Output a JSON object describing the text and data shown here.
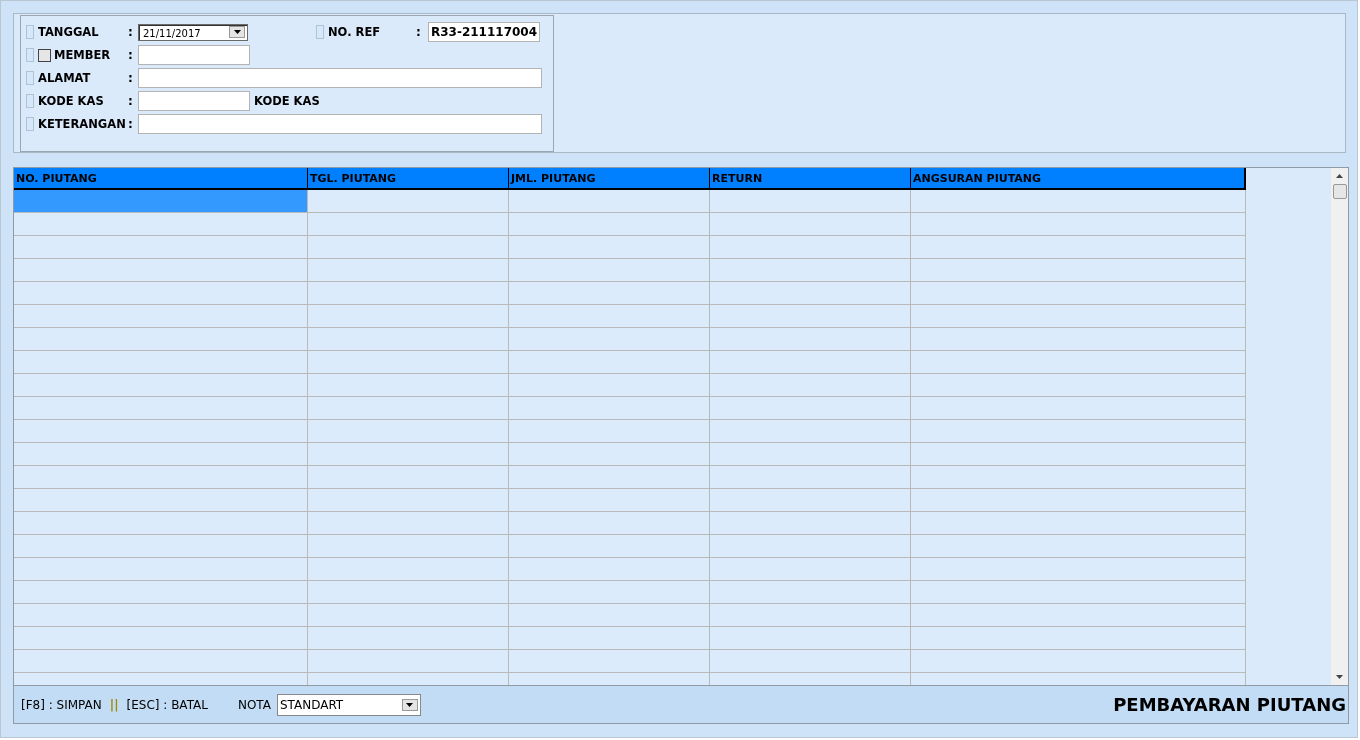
{
  "form": {
    "fields": [
      {
        "kind": "date",
        "label": "TANGGAL",
        "colon": ":",
        "value": "21/11/2017"
      },
      {
        "kind": "member",
        "label": "MEMBER",
        "colon": ":",
        "checked": false
      },
      {
        "kind": "wide",
        "label": "ALAMAT",
        "colon": ":"
      },
      {
        "kind": "kas",
        "label": "KODE KAS",
        "colon": ":",
        "suffix": "KODE KAS"
      },
      {
        "kind": "wide",
        "label": "KETERANGAN",
        "colon": ":"
      }
    ],
    "no_ref": {
      "label": "NO. REF",
      "colon": ":",
      "value": "R33-211117004"
    }
  },
  "table": {
    "columns": [
      "NO. PIUTANG",
      "TGL. PIUTANG",
      "JML. PIUTANG",
      "RETURN",
      "ANGSURAN PIUTANG"
    ],
    "rows": [
      {
        "selected": true
      },
      {
        "selected": false
      },
      {
        "selected": false
      },
      {
        "selected": false
      },
      {
        "selected": false
      },
      {
        "selected": false
      },
      {
        "selected": false
      },
      {
        "selected": false
      },
      {
        "selected": false
      },
      {
        "selected": false
      },
      {
        "selected": false
      },
      {
        "selected": false
      },
      {
        "selected": false
      },
      {
        "selected": false
      },
      {
        "selected": false
      },
      {
        "selected": false
      },
      {
        "selected": false
      },
      {
        "selected": false
      },
      {
        "selected": false
      },
      {
        "selected": false
      },
      {
        "selected": false
      },
      {
        "selected": false
      }
    ]
  },
  "footer": {
    "shortcuts": [
      "[F8] : SIMPAN",
      "||",
      "[ESC] : BATAL"
    ],
    "nota_label": "NOTA",
    "nota_value": "STANDART",
    "title": "PEMBAYARAN PIUTANG"
  }
}
